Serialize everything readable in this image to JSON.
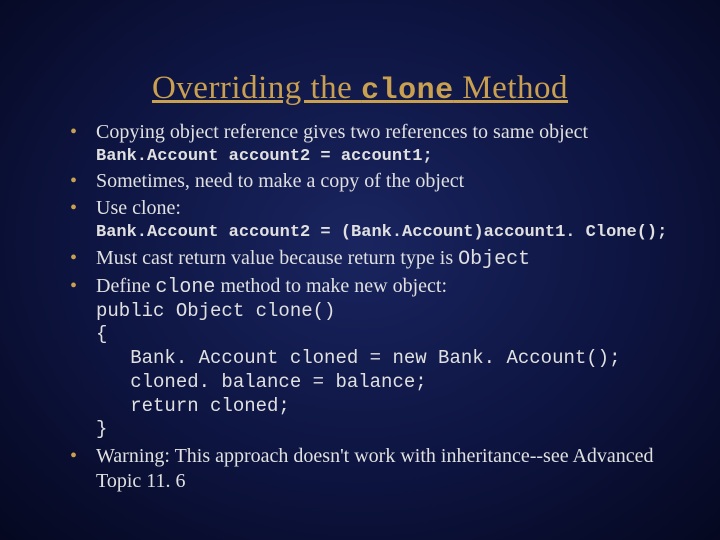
{
  "title": {
    "pre": "Overriding the ",
    "mono": "clone",
    "post": " Method"
  },
  "bullets": {
    "b1": {
      "text": "Copying object reference gives two references to same object",
      "code": "Bank.Account account2 = account1;"
    },
    "b2": {
      "text": "Sometimes, need to make a copy of the object"
    },
    "b3": {
      "text": "Use clone:",
      "code": "Bank.Account account2 = (Bank.Account)account1. Clone();"
    },
    "b4": {
      "pre": "Must cast return value because return type is ",
      "mono": "Object"
    },
    "b5": {
      "pre": "Define ",
      "mono": "clone",
      "post": " method to make new object:",
      "code": "public Object clone()\n{\n   Bank. Account cloned = new Bank. Account();\n   cloned. balance = balance;\n   return cloned;\n}"
    },
    "b6": {
      "text": "Warning: This approach doesn't work with inheritance--see Advanced Topic 11. 6"
    }
  }
}
